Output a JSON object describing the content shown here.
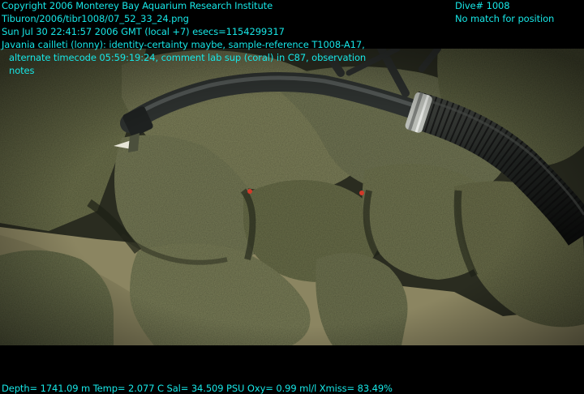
{
  "overlay": {
    "copyright": "Copyright 2006 Monterey Bay Aquarium Research Institute",
    "filename": "Tiburon/2006/tibr1008/07_52_33_24.png",
    "timestamp": "Sun Jul 30 22:41:57 2006 GMT (local +7)  esecs=1154299317",
    "annotation_line1": "Javania cailleti (lonny): identity-certainty maybe, sample-reference T1008-A17,",
    "annotation_line2": "alternate timecode 05:59:19:24, comment lab sup (coral) in C87, observation",
    "annotation_line3": "notes",
    "dive": "Dive# 1008",
    "position": "No match for position",
    "telemetry": "Depth= 1741.09 m  Temp= 2.077 C  Sal= 34.509 PSU  Oxy= 0.99 ml/l  Xmiss= 83.49%"
  },
  "colors": {
    "overlay_text": "#17e6e6",
    "background": "#000000",
    "rock": "#6f7352",
    "sediment": "#8c8662"
  }
}
